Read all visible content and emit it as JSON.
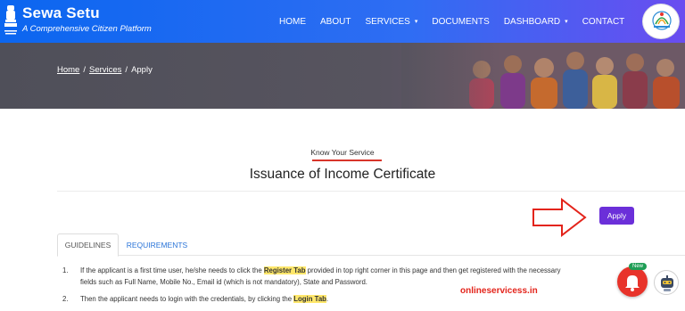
{
  "header": {
    "brand_title": "Sewa Setu",
    "brand_subtitle": "A Comprehensive Citizen Platform",
    "nav": [
      {
        "label": "HOME",
        "dropdown": false
      },
      {
        "label": "ABOUT",
        "dropdown": false
      },
      {
        "label": "SERVICES",
        "dropdown": true
      },
      {
        "label": "DOCUMENTS",
        "dropdown": false
      },
      {
        "label": "DASHBOARD",
        "dropdown": true
      },
      {
        "label": "CONTACT",
        "dropdown": false
      }
    ],
    "logo_text": "Sewa Setu",
    "caret_glyph": "▾",
    "brand_color": "#0b66f0"
  },
  "breadcrumb": {
    "home": "Home",
    "services": "Services",
    "current": "Apply",
    "separator": "/"
  },
  "main": {
    "eyebrow": "Know Your Service",
    "title": "Issuance of Income Certificate",
    "apply_label": "Apply",
    "apply_color": "#6b2fd9"
  },
  "tabs": [
    {
      "label": "GUIDELINES",
      "active": true
    },
    {
      "label": "REQUIREMENTS",
      "active": false
    }
  ],
  "guidelines": [
    {
      "num": "1.",
      "pre": "If the applicant is a first time user, he/she needs to click the ",
      "highlight": "Register Tab",
      "post": " provided in top right corner in this page and then get registered with the necessary",
      "line2": "fields such as Full Name, Mobile No., Email id (which is not mandatory), State and Password."
    },
    {
      "num": "2.",
      "pre": "Then the applicant needs to login with the credentials, by clicking the ",
      "highlight": "Login Tab",
      "post": "."
    }
  ],
  "watermark": "onlineservicess.in",
  "widgets": {
    "notification_badge": "New"
  }
}
